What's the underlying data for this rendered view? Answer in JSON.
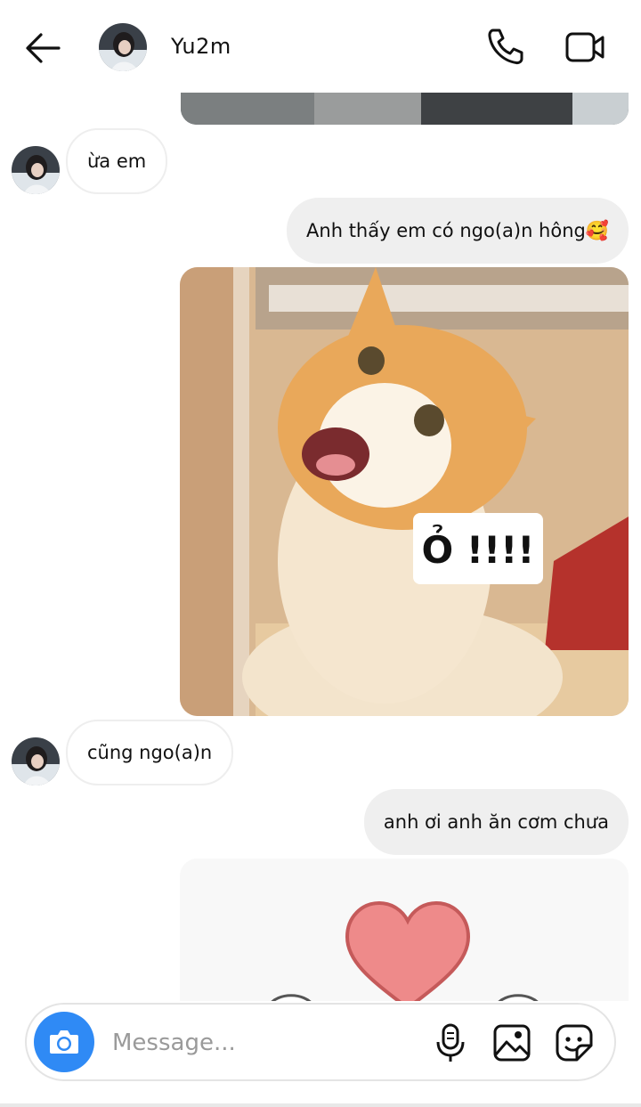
{
  "header": {
    "contact_name": "Yu2m",
    "back_icon": "arrow-left-icon",
    "call_icon": "phone-icon",
    "video_icon": "video-camera-icon"
  },
  "messages": [
    {
      "type": "incoming",
      "text": "ừa em"
    },
    {
      "type": "outgoing",
      "text": "Anh thấy em có ngo(a)n hông🥰"
    },
    {
      "type": "outgoing_image",
      "caption_in_image": "Ỏ !!!!"
    },
    {
      "type": "incoming",
      "text": "cũng ngo(a)n"
    },
    {
      "type": "outgoing",
      "text": "anh ơi anh ăn cơm chưa"
    },
    {
      "type": "outgoing_image",
      "caption_in_image": ""
    }
  ],
  "composer": {
    "placeholder": "Message...",
    "camera_icon": "camera-icon",
    "mic_icon": "microphone-icon",
    "gallery_icon": "gallery-icon",
    "sticker_icon": "sticker-icon"
  },
  "colors": {
    "accent": "#2f8af5",
    "outgoing_bubble": "#efefef",
    "incoming_border": "#eeeeee"
  }
}
